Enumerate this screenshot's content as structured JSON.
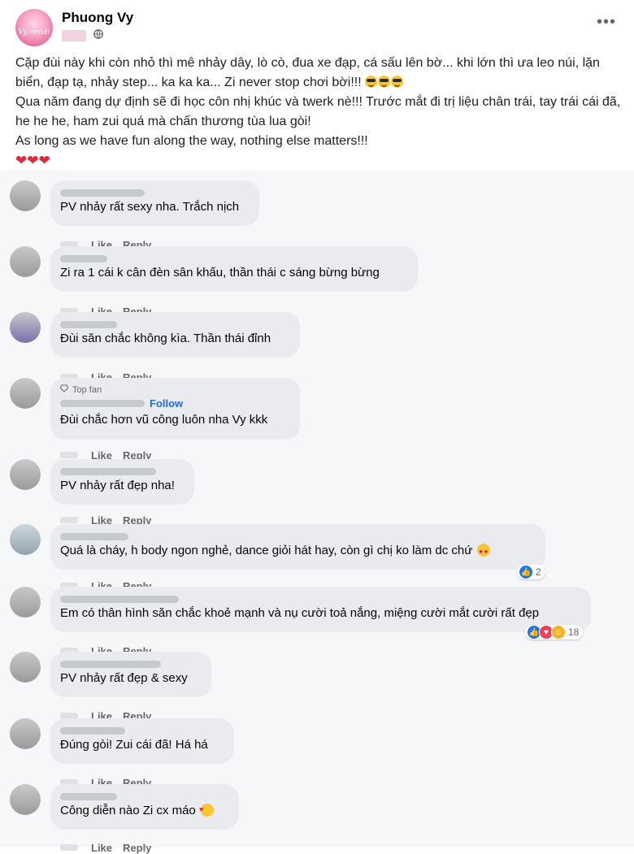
{
  "post": {
    "author": "Phuong Vy",
    "avatar_brand": "Vy cendi",
    "more_icon": "more-horizontal-icon",
    "privacy_icon": "globe-icon",
    "paragraphs": [
      "Cặp đùi này khi còn nhỏ thì mê nhảy dây, lò cò, đua xe đạp, cá sấu lên bờ... khi lớn thì ưa leo núi, lặn biển, đạp tạ, nhảy step... ka ka ka... Zi never stop chơi bời!!!",
      "Qua năm đang dự định sẽ đi học côn nhị khúc và twerk nè!!! Trước mắt đi trị liệu chân trái, tay trái cái đã, he he he, ham zui quá mà chấn thương tùa lua gòi!",
      "As long as we have fun along the way, nothing else matters!!!"
    ],
    "hearts": "❤❤❤"
  },
  "labels": {
    "like": "Like",
    "reply": "Reply"
  },
  "comments": [
    {
      "name": "Hoa Giang Nam",
      "text": "PV nhảy rất sexy nha. Trắch nịch"
    },
    {
      "name": "Khải Huy",
      "text": "Zi ra 1 cái k cân đèn sân khấu, thần thái c sáng bừng bừng"
    },
    {
      "name": "Hồng Di",
      "text": "Đùi săn chắc không kìa. Thần thái đỉnh"
    },
    {
      "badge": "Top fan",
      "follow": "Follow",
      "text": "Đùi chắc hơn vũ công luôn nha Vy kkk"
    },
    {
      "text": "PV nhảy rất đẹp nha!"
    },
    {
      "text": "Quá là cháy, h body ngon nghẻ, dance giỏi hát hay, còn gì chị ko làm dc chứ",
      "reaction_count": "2"
    },
    {
      "text": "Em có thân hình săn chắc khoẻ mạnh và nụ cười toả nắng, miệng cười mắt cười rất đẹp",
      "reaction_count": "18"
    },
    {
      "text": "PV nhảy rất đẹp & sexy"
    },
    {
      "text": "Đúng gòi! Zui cái đã! Há há"
    },
    {
      "text": "Công diễn nào Zi cx máo"
    }
  ]
}
